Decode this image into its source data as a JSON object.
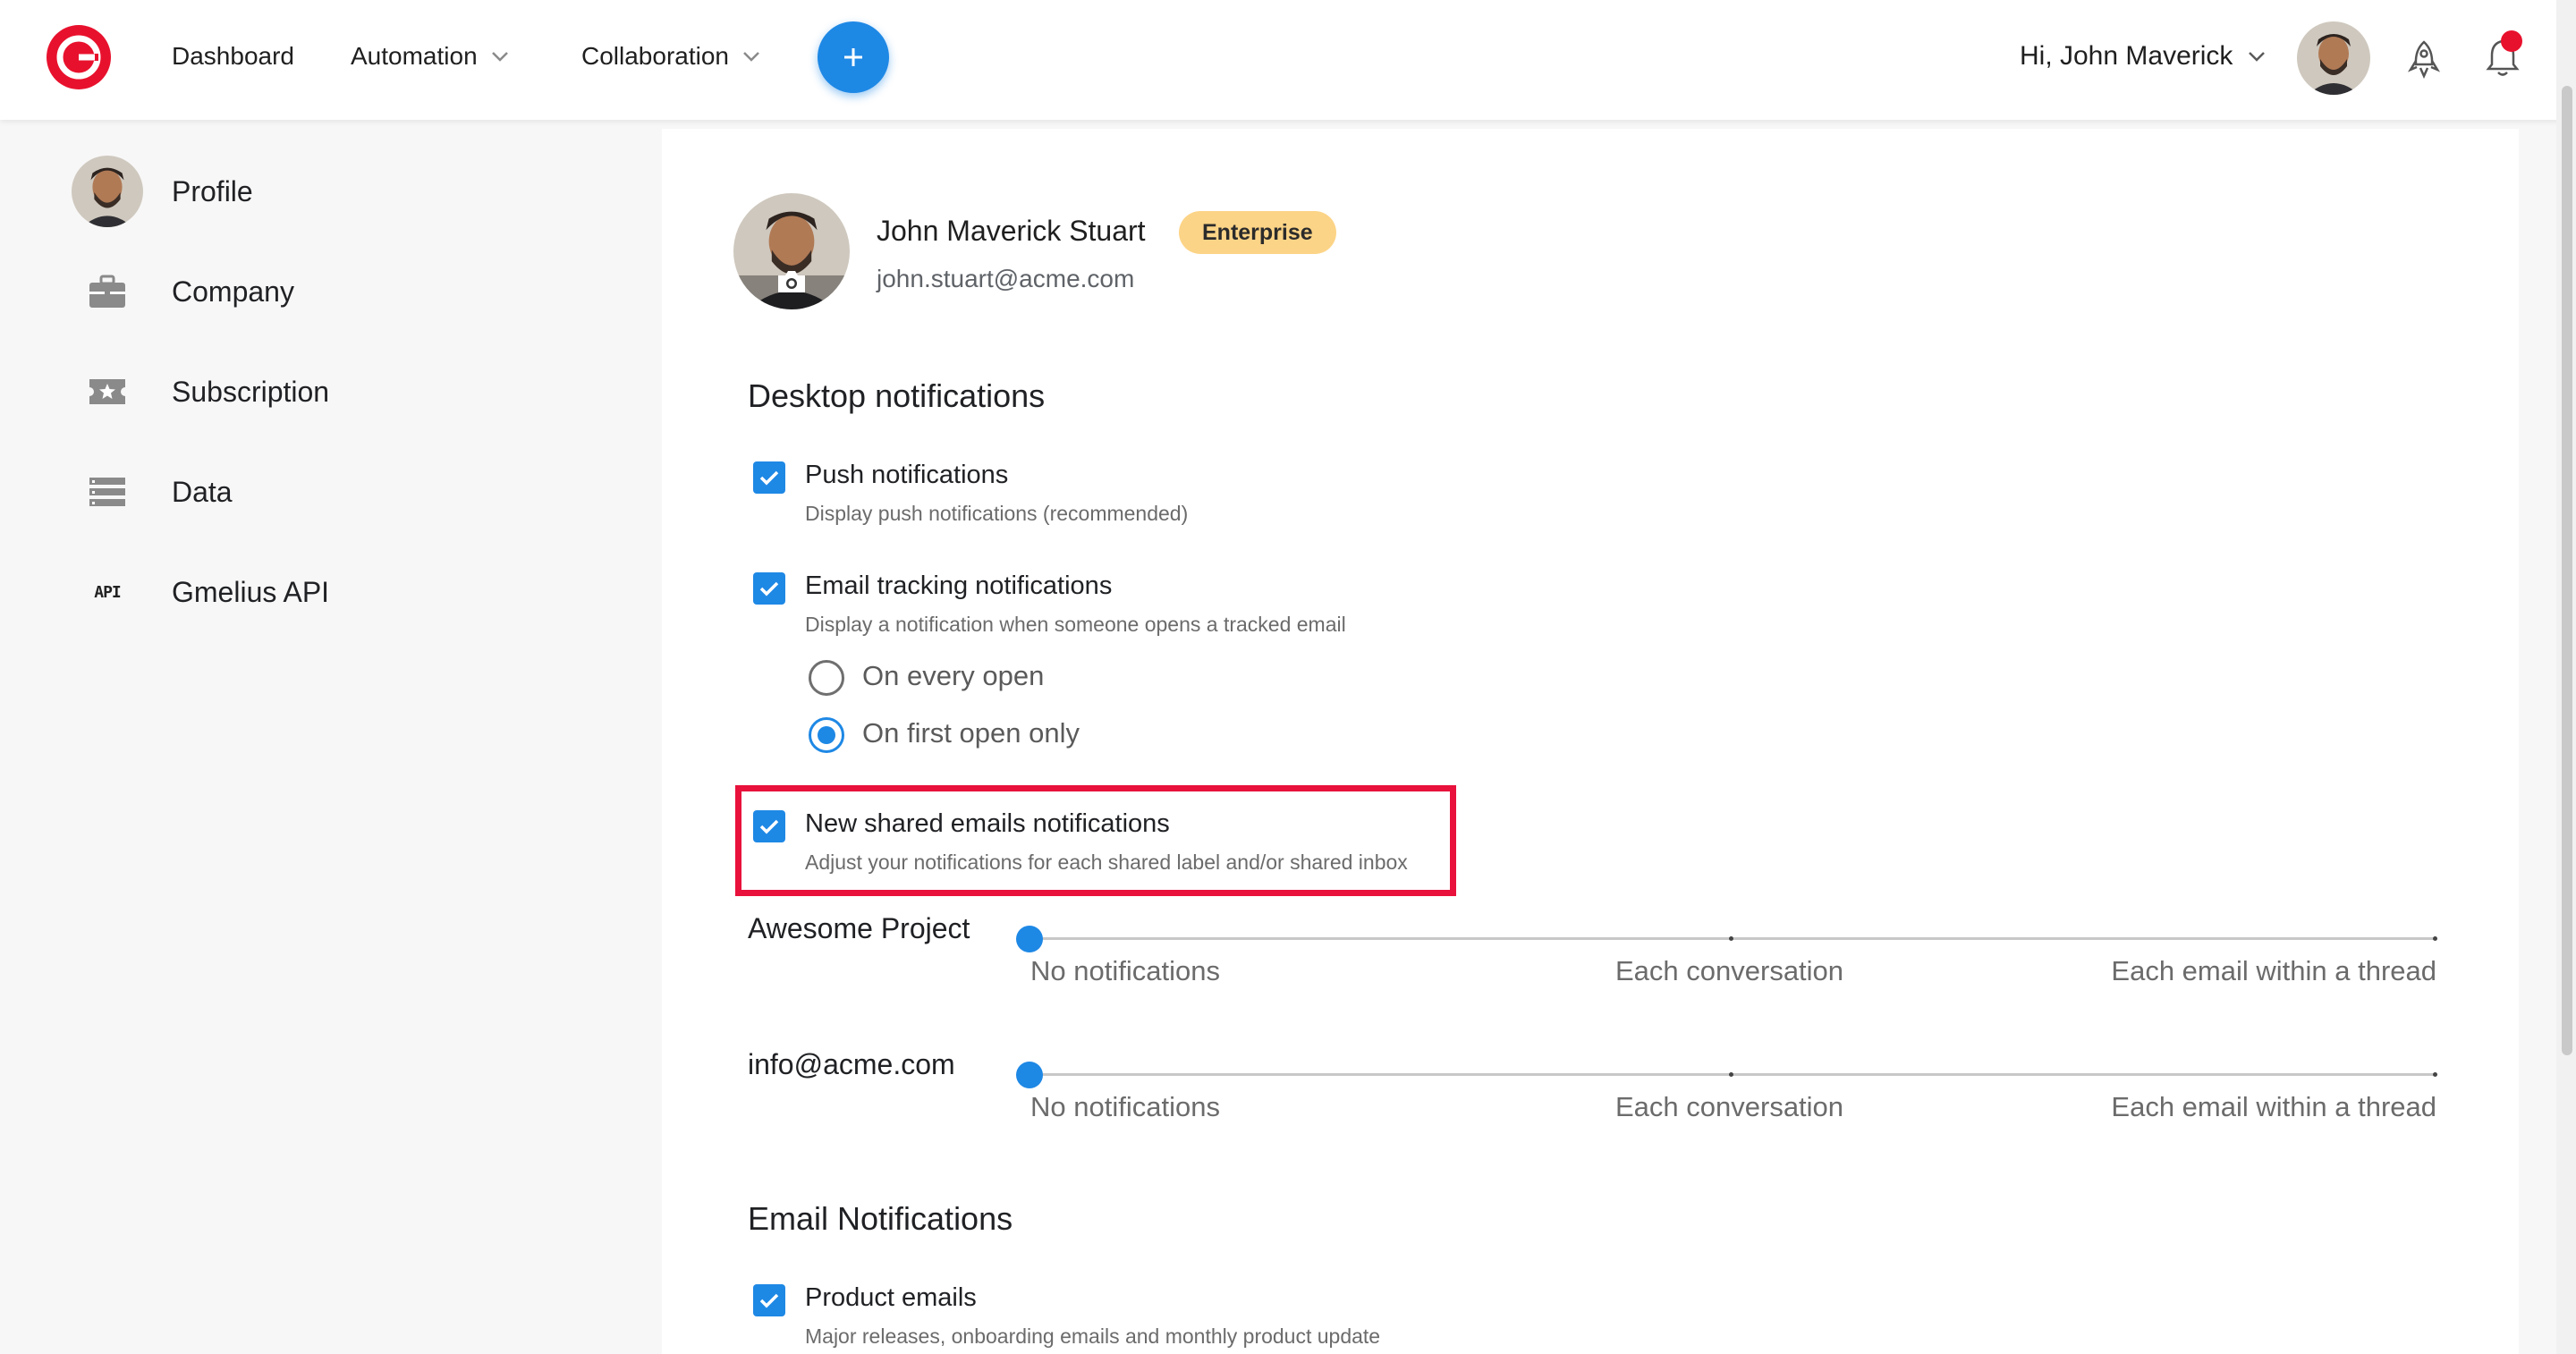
{
  "nav": {
    "dashboard": "Dashboard",
    "automation": "Automation",
    "collaboration": "Collaboration",
    "greeting": "Hi, John Maverick"
  },
  "sidebar": {
    "items": [
      {
        "label": "Profile",
        "icon": "avatar"
      },
      {
        "label": "Company",
        "icon": "briefcase-icon"
      },
      {
        "label": "Subscription",
        "icon": "ticket-star-icon"
      },
      {
        "label": "Data",
        "icon": "database-icon"
      },
      {
        "label": "Gmelius API",
        "icon": "api-icon",
        "icon_text": "API"
      }
    ]
  },
  "profile": {
    "name": "John Maverick Stuart",
    "plan": "Enterprise",
    "email": "john.stuart@acme.com"
  },
  "desktop": {
    "title": "Desktop notifications",
    "push": {
      "title": "Push notifications",
      "sub": "Display push notifications (recommended)",
      "checked": true
    },
    "tracking": {
      "title": "Email tracking notifications",
      "sub": "Display a notification when someone opens a tracked email",
      "checked": true,
      "options": [
        "On every open",
        "On first open only"
      ],
      "selected": 1
    },
    "shared": {
      "title": "New shared emails notifications",
      "sub": "Adjust your notifications for each shared label and/or shared inbox",
      "checked": true
    }
  },
  "sliders": {
    "stops": [
      "No notifications",
      "Each conversation",
      "Each email within a thread"
    ],
    "rows": [
      {
        "label": "Awesome Project",
        "value": 0
      },
      {
        "label": "info@acme.com",
        "value": 0
      }
    ]
  },
  "email": {
    "title": "Email Notifications",
    "product": {
      "title": "Product emails",
      "sub": "Major releases, onboarding emails and monthly product update",
      "checked": true
    }
  },
  "colors": {
    "accent": "#1e88e5",
    "badge": "#fcd487",
    "highlight": "#e8123c",
    "brand": "#e8112d"
  }
}
